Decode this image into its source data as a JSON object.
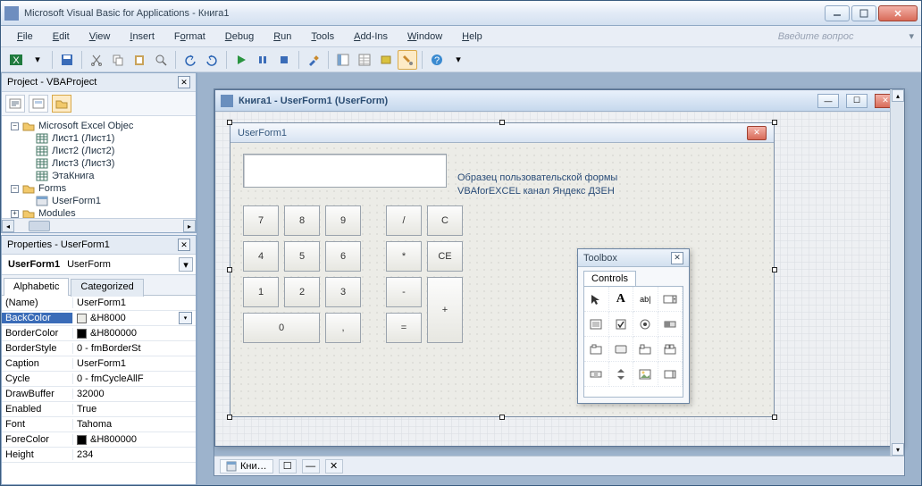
{
  "app": {
    "title": "Microsoft Visual Basic for Applications - Книга1"
  },
  "menu": {
    "items": [
      "File",
      "Edit",
      "View",
      "Insert",
      "Format",
      "Debug",
      "Run",
      "Tools",
      "Add-Ins",
      "Window",
      "Help"
    ],
    "question": "Введите вопрос"
  },
  "projectPanel": {
    "title": "Project - VBAProject",
    "excelFolder": "Microsoft Excel Objeс",
    "sheets": [
      "Лист1 (Лист1)",
      "Лист2 (Лист2)",
      "Лист3 (Лист3)",
      "ЭтаКнига"
    ],
    "formsFolder": "Forms",
    "forms": [
      "UserForm1"
    ],
    "modulesFolder": "Modules"
  },
  "propsPanel": {
    "title": "Properties - UserForm1",
    "objName": "UserForm1",
    "objType": "UserForm",
    "tabs": {
      "a": "Alphabetic",
      "b": "Categorized"
    },
    "rows": [
      {
        "k": "(Name)",
        "v": "UserForm1"
      },
      {
        "k": "BackColor",
        "v": "&H8000",
        "swatch": "#ecece7",
        "sel": true,
        "dd": true
      },
      {
        "k": "BorderColor",
        "v": "&H800000",
        "swatch": "#000000"
      },
      {
        "k": "BorderStyle",
        "v": "0 - fmBorderSt"
      },
      {
        "k": "Caption",
        "v": "UserForm1"
      },
      {
        "k": "Cycle",
        "v": "0 - fmCycleAllF"
      },
      {
        "k": "DrawBuffer",
        "v": "32000"
      },
      {
        "k": "Enabled",
        "v": "True"
      },
      {
        "k": "Font",
        "v": "Tahoma"
      },
      {
        "k": "ForeColor",
        "v": "&H800000",
        "swatch": "#000000"
      },
      {
        "k": "Height",
        "v": "234"
      }
    ]
  },
  "formWin": {
    "title": "Книга1 - UserForm1 (UserForm)"
  },
  "userForm": {
    "caption": "UserForm1",
    "hint1": "Образец пользовательской формы",
    "hint2": "VBAforEXCEL канал Яндекс ДЗЕН",
    "keys": {
      "k7": "7",
      "k8": "8",
      "k9": "9",
      "div": "/",
      "c": "C",
      "k4": "4",
      "k5": "5",
      "k6": "6",
      "mul": "*",
      "ce": "CE",
      "k1": "1",
      "k2": "2",
      "k3": "3",
      "sub": "-",
      "plus": "+",
      "k0": "0",
      "comma": ",",
      "eq": "="
    }
  },
  "toolbox": {
    "title": "Toolbox",
    "tab": "Controls"
  },
  "taskbar": {
    "label": "Кни…"
  }
}
